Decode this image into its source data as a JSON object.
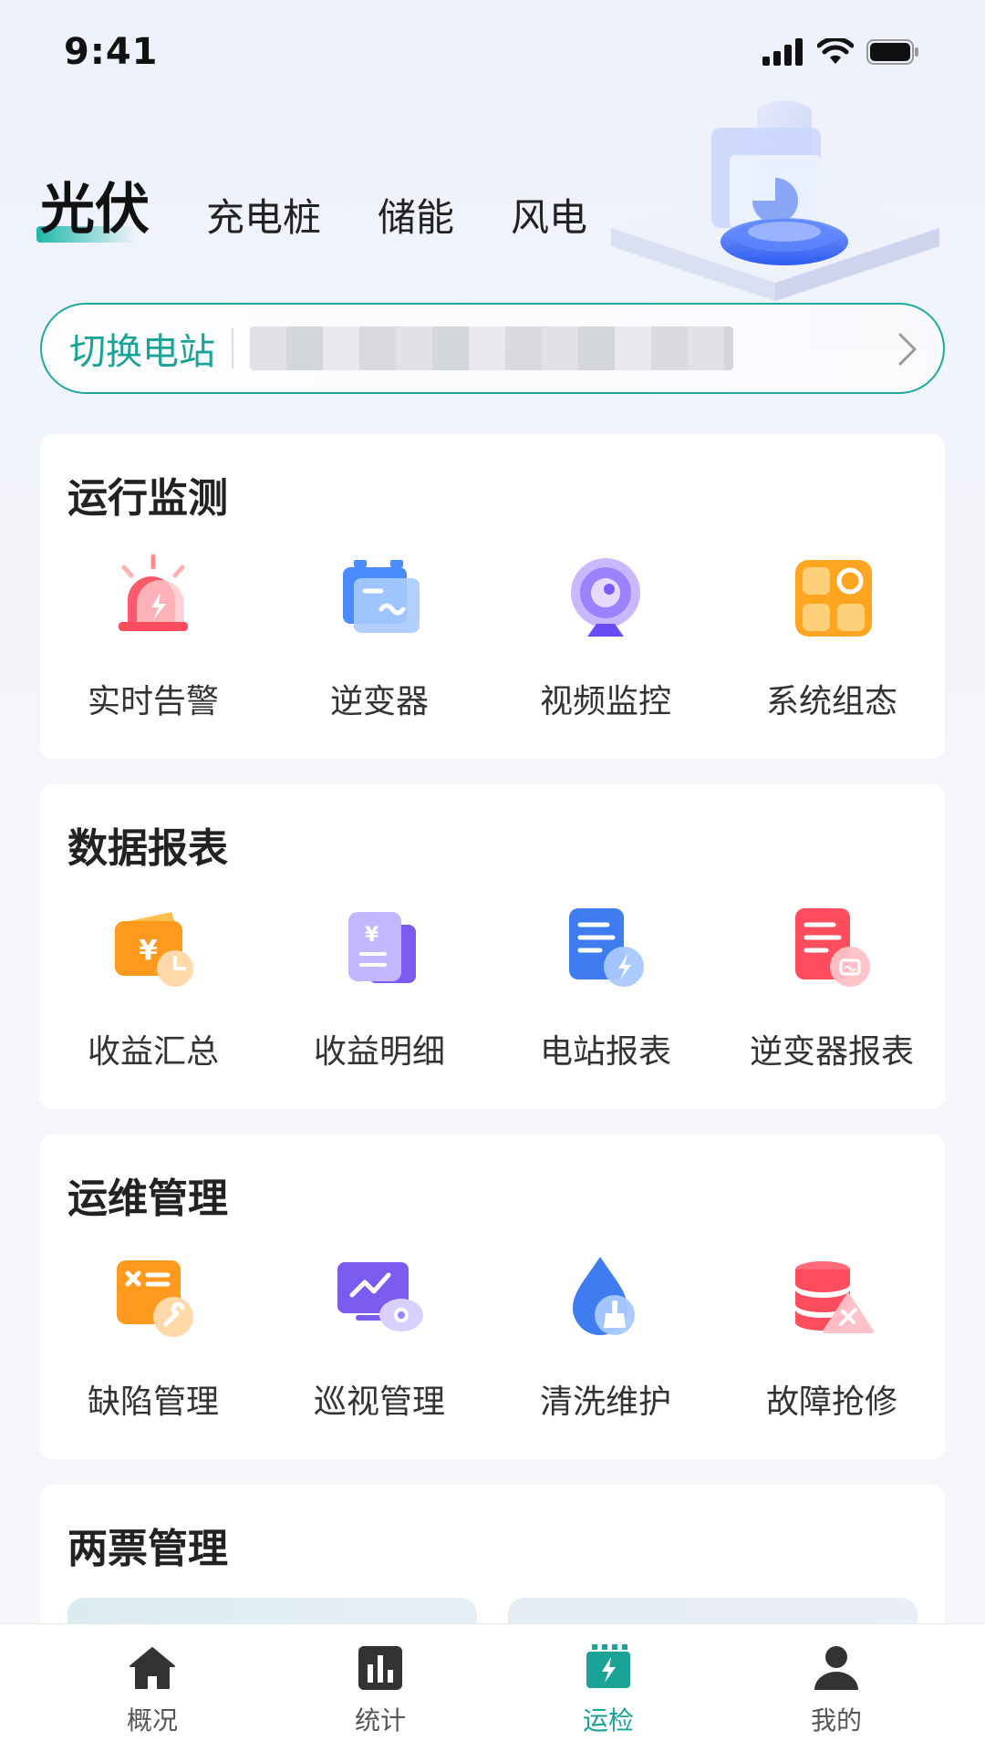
{
  "status": {
    "time": "9:41"
  },
  "top_tabs": [
    {
      "label": "光伏",
      "active": true
    },
    {
      "label": "充电桩",
      "active": false
    },
    {
      "label": "储能",
      "active": false
    },
    {
      "label": "风电",
      "active": false
    }
  ],
  "station": {
    "label": "切换电站"
  },
  "sections": [
    {
      "title": "运行监测",
      "items": [
        {
          "label": "实时告警",
          "icon": "alarm-siren-icon"
        },
        {
          "label": "逆变器",
          "icon": "inverter-icon"
        },
        {
          "label": "视频监控",
          "icon": "camera-icon"
        },
        {
          "label": "系统组态",
          "icon": "system-config-icon"
        }
      ]
    },
    {
      "title": "数据报表",
      "items": [
        {
          "label": "收益汇总",
          "icon": "wallet-icon"
        },
        {
          "label": "收益明细",
          "icon": "income-detail-icon"
        },
        {
          "label": "电站报表",
          "icon": "station-report-icon"
        },
        {
          "label": "逆变器报表",
          "icon": "inverter-report-icon"
        }
      ]
    },
    {
      "title": "运维管理",
      "items": [
        {
          "label": "缺陷管理",
          "icon": "defect-icon"
        },
        {
          "label": "巡视管理",
          "icon": "patrol-icon"
        },
        {
          "label": "清洗维护",
          "icon": "cleaning-icon"
        },
        {
          "label": "故障抢修",
          "icon": "repair-icon"
        }
      ]
    },
    {
      "title": "两票管理",
      "items": []
    }
  ],
  "bottom_nav": [
    {
      "label": "概况",
      "icon": "home-icon",
      "active": false
    },
    {
      "label": "统计",
      "icon": "stats-icon",
      "active": false
    },
    {
      "label": "运检",
      "icon": "inspection-icon",
      "active": true
    },
    {
      "label": "我的",
      "icon": "user-icon",
      "active": false
    }
  ]
}
